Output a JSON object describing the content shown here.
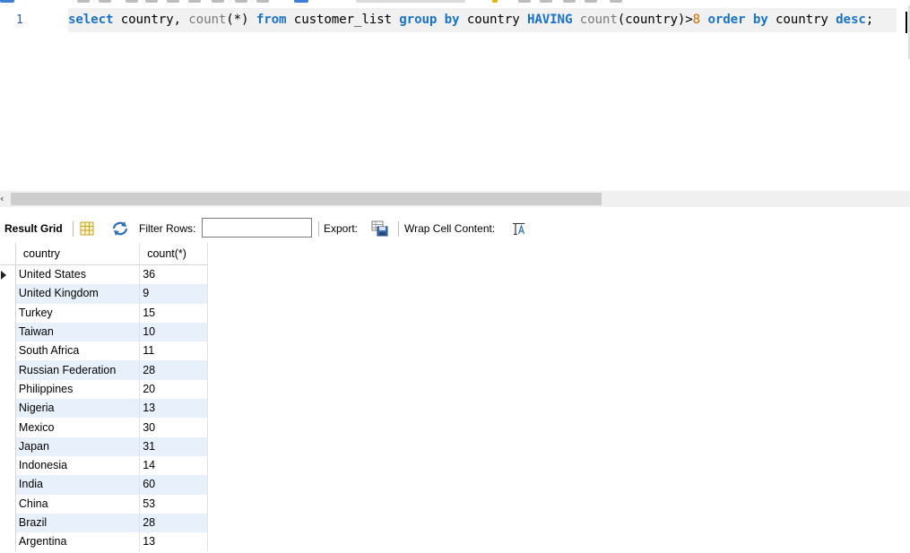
{
  "editor": {
    "line_number": "1",
    "tokens": [
      {
        "t": "select",
        "c": "kw"
      },
      {
        "t": " country, ",
        "c": "id"
      },
      {
        "t": "count",
        "c": "fn"
      },
      {
        "t": "(*) ",
        "c": "id"
      },
      {
        "t": "from",
        "c": "kw"
      },
      {
        "t": " customer_list ",
        "c": "id"
      },
      {
        "t": "group",
        "c": "kw"
      },
      {
        "t": " ",
        "c": "id"
      },
      {
        "t": "by",
        "c": "kw"
      },
      {
        "t": " country ",
        "c": "id"
      },
      {
        "t": "HAVING",
        "c": "kw"
      },
      {
        "t": " ",
        "c": "id"
      },
      {
        "t": "count",
        "c": "fn"
      },
      {
        "t": "(country)>",
        "c": "id"
      },
      {
        "t": "8",
        "c": "num"
      },
      {
        "t": " ",
        "c": "id"
      },
      {
        "t": "order",
        "c": "kw"
      },
      {
        "t": " ",
        "c": "id"
      },
      {
        "t": "by",
        "c": "kw"
      },
      {
        "t": " country ",
        "c": "id"
      },
      {
        "t": "desc",
        "c": "kw"
      },
      {
        "t": ";",
        "c": "id"
      }
    ]
  },
  "scrollbar": {
    "arrow": "‹"
  },
  "toolbar": {
    "result_grid_label": "Result Grid",
    "filter_label": "Filter Rows:",
    "filter_value": "",
    "export_label": "Export:",
    "wrap_label": "Wrap Cell Content:"
  },
  "grid": {
    "headers": [
      "country",
      "count(*)"
    ],
    "rows": [
      [
        "United States",
        "36"
      ],
      [
        "United Kingdom",
        "9"
      ],
      [
        "Turkey",
        "15"
      ],
      [
        "Taiwan",
        "10"
      ],
      [
        "South Africa",
        "11"
      ],
      [
        "Russian Federation",
        "28"
      ],
      [
        "Philippines",
        "20"
      ],
      [
        "Nigeria",
        "13"
      ],
      [
        "Mexico",
        "30"
      ],
      [
        "Japan",
        "31"
      ],
      [
        "Indonesia",
        "14"
      ],
      [
        "India",
        "60"
      ],
      [
        "China",
        "53"
      ],
      [
        "Brazil",
        "28"
      ],
      [
        "Argentina",
        "13"
      ]
    ]
  },
  "colors": {
    "keyword": "#1a73c9",
    "function": "#7a7a7a",
    "number": "#d06a00",
    "row_alt": "#e8f1fb"
  }
}
